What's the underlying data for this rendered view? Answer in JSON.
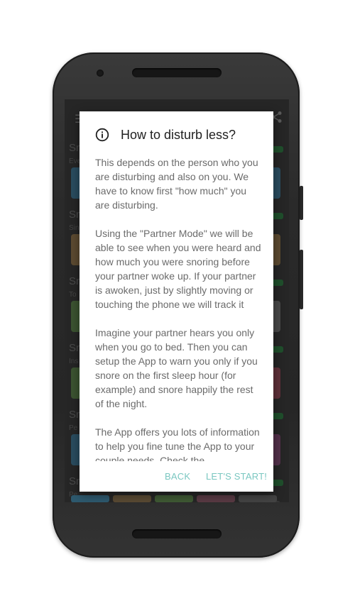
{
  "background_app": {
    "menu_icon": "hamburger-menu-icon",
    "share_icon": "share-icon",
    "rows": [
      {
        "title": "Sn",
        "subtitle": "Eve",
        "left_color": "#2e6d8f",
        "right_color": "#2e6d8f"
      },
      {
        "title": "Sn",
        "subtitle": "Sin",
        "left_color": "#8a6a3a",
        "right_color": "#8a6a3a"
      },
      {
        "title": "Sn",
        "subtitle": "To",
        "left_color": "#4f7a3a",
        "right_color": "#666666"
      },
      {
        "title": "Sn",
        "subtitle": "Ins",
        "left_color": "#4f7a3a",
        "right_color": "#8f3a4a"
      },
      {
        "title": "Sn",
        "subtitle": "Pe",
        "left_color": "#2e6d8f",
        "right_color": "#7a3a6a"
      },
      {
        "title": "Sn",
        "subtitle": "Pe",
        "left_color": "#2e6d8f",
        "right_color": "#444444"
      }
    ]
  },
  "dialog": {
    "icon": "info-icon",
    "title": "How to disturb less?",
    "paragraphs": [
      "This depends on the person who you are disturbing and also on you. We have to know first \"how much\" you are disturbing.",
      "Using the \"Partner Mode\" we will be able to see when you were heard and how much you were snoring before your partner woke up. If your partner is awoken, just by slightly moving or touching the phone we will track it",
      "Imagine your partner hears you only when you go to bed. Then you can setup the App to warn you only if you snore on the first sleep hour (for example) and snore happily the rest of the night.",
      "The App offers you lots of information to help you fine tune the App to your couple needs. Check the"
    ],
    "buttons": {
      "back": "BACK",
      "start": "LET'S START!"
    },
    "accent_color": "#7ac7c1"
  }
}
